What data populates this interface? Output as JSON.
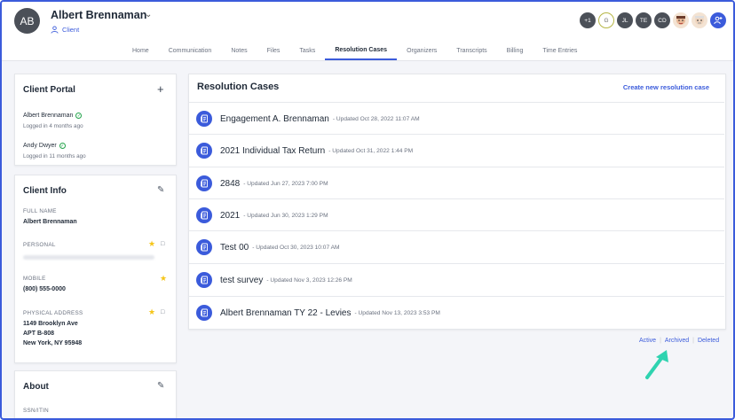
{
  "client": {
    "initials": "AB",
    "name": "Albert Brennaman",
    "type": "Client"
  },
  "people": [
    {
      "label": "+1",
      "kind": "count"
    },
    {
      "label": "G",
      "kind": "outline"
    },
    {
      "label": "JL",
      "kind": "initials"
    },
    {
      "label": "TE",
      "kind": "initials"
    },
    {
      "label": "CD",
      "kind": "initials"
    },
    {
      "label": "",
      "kind": "face"
    },
    {
      "label": "",
      "kind": "face"
    },
    {
      "label": "",
      "kind": "add"
    }
  ],
  "tabs": [
    "Home",
    "Communication",
    "Notes",
    "Files",
    "Tasks",
    "Resolution Cases",
    "Organizers",
    "Transcripts",
    "Billing",
    "Time Entries"
  ],
  "active_tab": "Resolution Cases",
  "portal": {
    "title": "Client Portal",
    "users": [
      {
        "name": "Albert Brennaman",
        "login": "Logged in 4 months ago"
      },
      {
        "name": "Andy Dwyer",
        "login": "Logged in 11 months ago"
      }
    ]
  },
  "info": {
    "title": "Client Info",
    "full_name_label": "FULL NAME",
    "full_name": "Albert Brennaman",
    "personal_label": "PERSONAL",
    "mobile_label": "MOBILE",
    "mobile": "(800) 555-0000",
    "address_label": "PHYSICAL ADDRESS",
    "address_line1": "1149 Brooklyn Ave",
    "address_line2": "APT B-808",
    "address_line3": "New York, NY 95948"
  },
  "about": {
    "title": "About",
    "ssn_label": "SSN/ITIN"
  },
  "cases": {
    "title": "Resolution Cases",
    "create_label": "Create new resolution case",
    "items": [
      {
        "name": "Engagement A. Brennaman",
        "updated": "- Updated Oct 28, 2022 11:07 AM"
      },
      {
        "name": "2021 Individual Tax Return",
        "updated": "- Updated Oct 31, 2022 1:44 PM"
      },
      {
        "name": "2848",
        "updated": "- Updated Jun 27, 2023 7:00 PM"
      },
      {
        "name": "2021",
        "updated": "- Updated Jun 30, 2023 1:29 PM"
      },
      {
        "name": "Test 00",
        "updated": "- Updated Oct 30, 2023 10:07 AM"
      },
      {
        "name": "test survey",
        "updated": "- Updated Nov 3, 2023 12:26 PM"
      },
      {
        "name": "Albert Brennaman TY 22 - Levies",
        "updated": "- Updated Nov 13, 2023 3:53 PM"
      }
    ]
  },
  "filters": {
    "active": "Active",
    "archived": "Archived",
    "deleted": "Deleted",
    "separator": "|"
  },
  "colors": {
    "accent": "#3b5bdb",
    "arrow": "#2fd3b0",
    "check": "#22a34a",
    "star": "#f5c518"
  }
}
